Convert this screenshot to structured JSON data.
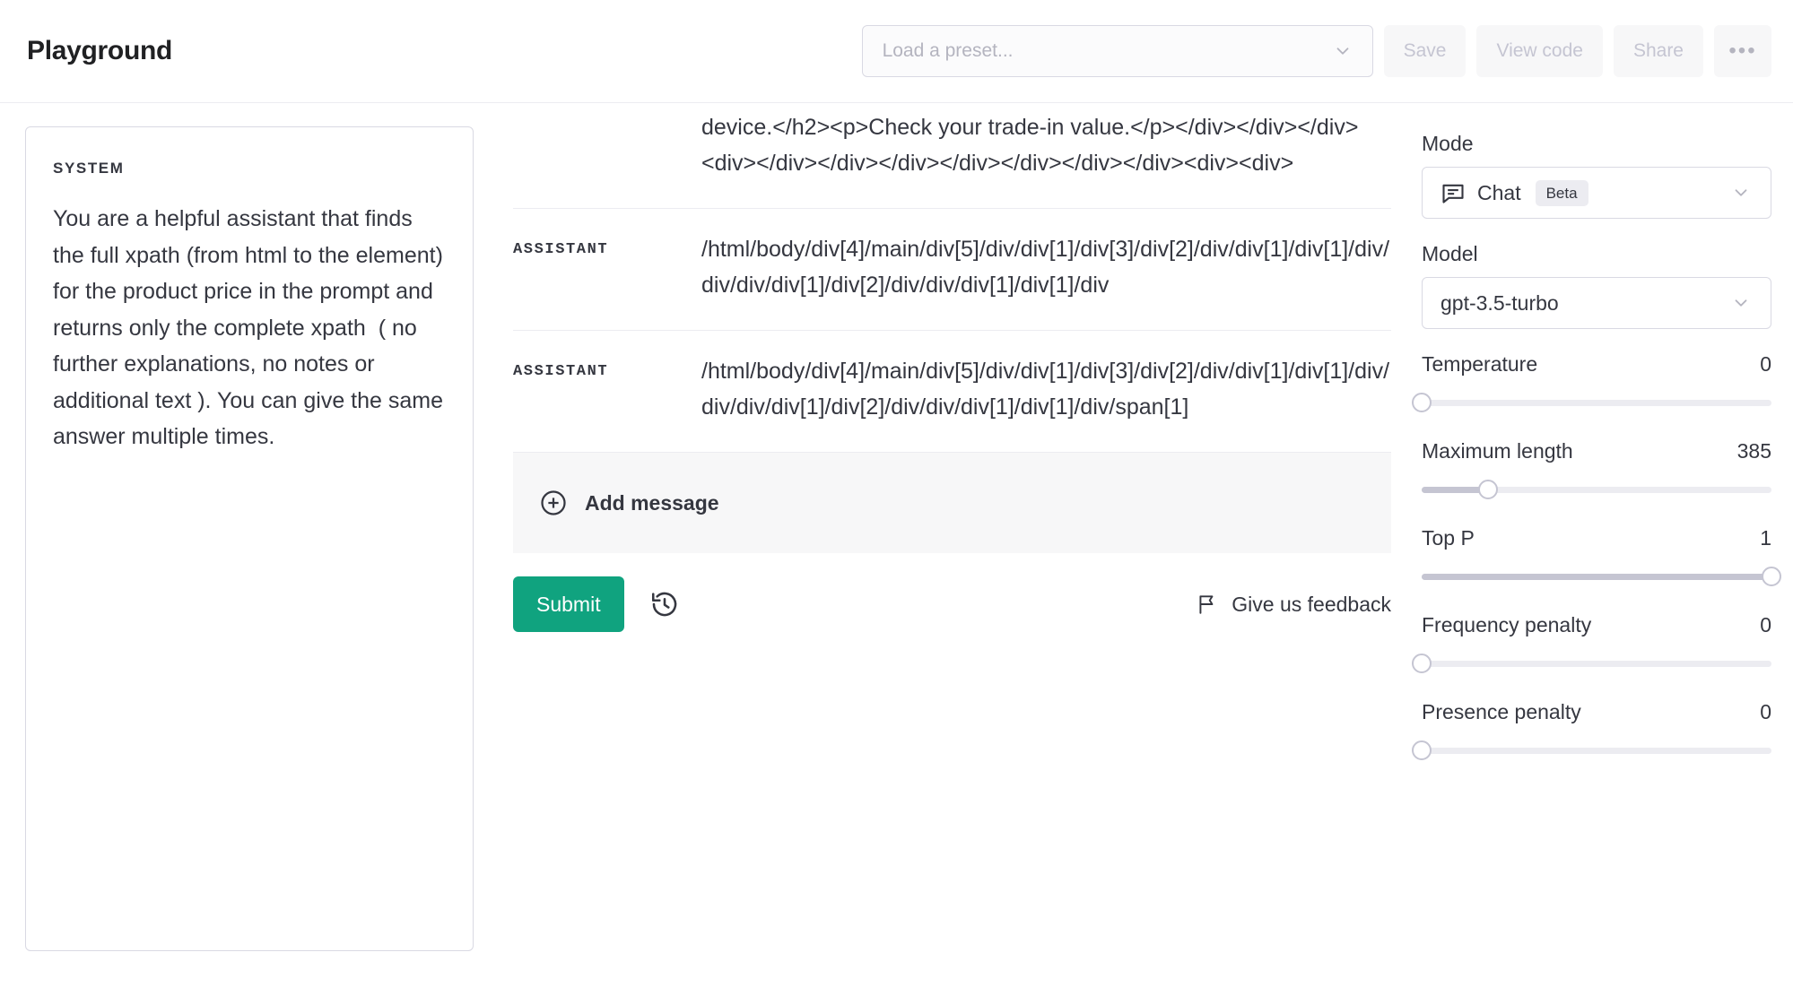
{
  "header": {
    "title": "Playground",
    "preset_placeholder": "Load a preset...",
    "save_label": "Save",
    "view_code_label": "View code",
    "share_label": "Share",
    "more_label": "•••"
  },
  "system": {
    "label": "SYSTEM",
    "text": "You are a helpful assistant that finds the full xpath (from html to the element) for the product price in the prompt and returns only the complete xpath  ( no further explanations, no notes or additional text ). You can give the same answer multiple times."
  },
  "conversation": {
    "messages": [
      {
        "role": "",
        "content": "device.</h2><p>Check your trade-in value.</p></div></div></div><div></div></div></div></div></div></div></div><div><div>"
      },
      {
        "role": "ASSISTANT",
        "content": "/html/body/div[4]/main/div[5]/div/div[1]/div[3]/div[2]/div/div[1]/div[1]/div/div/div/div[1]/div[2]/div/div/div[1]/div[1]/div"
      },
      {
        "role": "ASSISTANT",
        "content": "/html/body/div[4]/main/div[5]/div/div[1]/div[3]/div[2]/div/div[1]/div[1]/div/div/div/div[1]/div[2]/div/div/div[1]/div[1]/div/span[1]"
      }
    ],
    "add_message_label": "Add message",
    "submit_label": "Submit",
    "feedback_label": "Give us feedback"
  },
  "settings": {
    "mode_label": "Mode",
    "mode_value": "Chat",
    "mode_badge": "Beta",
    "model_label": "Model",
    "model_value": "gpt-3.5-turbo",
    "sliders": [
      {
        "name": "Temperature",
        "value": "0",
        "percent": 0
      },
      {
        "name": "Maximum length",
        "value": "385",
        "percent": 19
      },
      {
        "name": "Top P",
        "value": "1",
        "percent": 100
      },
      {
        "name": "Frequency penalty",
        "value": "0",
        "percent": 0
      },
      {
        "name": "Presence penalty",
        "value": "0",
        "percent": 0
      }
    ]
  },
  "colors": {
    "accent": "#10a37f",
    "border": "#d9d9e3",
    "muted": "#c5c5d2",
    "surface": "#f7f7f8"
  }
}
